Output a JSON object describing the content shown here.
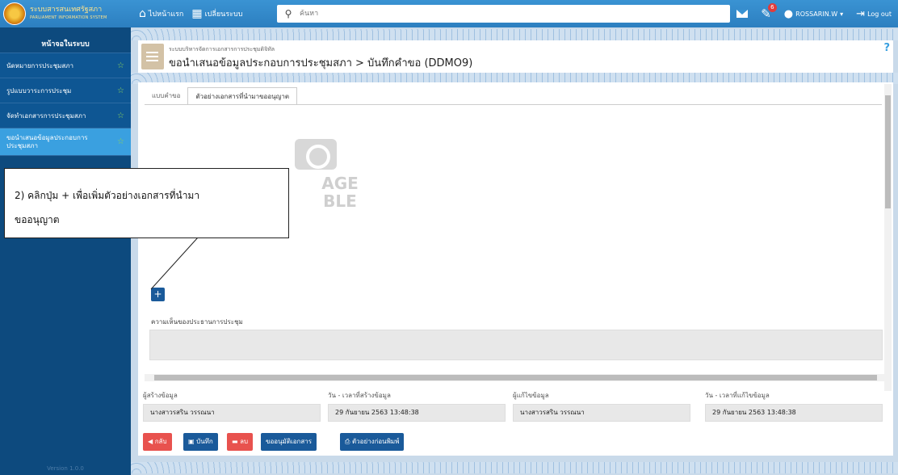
{
  "topbar": {
    "logo_line1": "ระบบสารสนเทศรัฐสภา",
    "logo_line2": "PARLIAMENT INFORMATION SYSTEM",
    "home_label": "ไปหน้าแรก",
    "switch_label": "เปลี่ยนระบบ",
    "search_placeholder": "ค้นหา",
    "notification_count": "6",
    "username": "ROSSARIN.W",
    "logout_label": "Log out"
  },
  "sidebar": {
    "header": "หน้าจอในระบบ",
    "items": [
      {
        "label": "นัดหมายการประชุมสภา"
      },
      {
        "label": "รูปแบบวาระการประชุม"
      },
      {
        "label": "จัดทำเอกสารการประชุมสภา"
      },
      {
        "label": "ขอนำเสนอข้อมูลประกอบการประชุมสภา"
      }
    ],
    "version": "Version 1.0.0"
  },
  "header": {
    "system_name": "ระบบบริหารจัดการเอกสารการประชุมดิจิทัล",
    "title": "ขอนำเสนอข้อมูลประกอบการประชุมสภา > บันทึกคำขอ (DDMO9)",
    "help": "?"
  },
  "tabs": [
    {
      "label": "แบบคำขอ"
    },
    {
      "label": "ตัวอย่างเอกสารที่นำมาขออนุญาต"
    }
  ],
  "placeholder_image": {
    "line1": "IMAGE",
    "line2": "AVAILABLE",
    "visible_line1": "AGE",
    "visible_line2": "BLE"
  },
  "add_button": "+",
  "comment": {
    "label": "ความเห็นของประธานการประชุม",
    "value": ""
  },
  "meta": {
    "created_by_label": "ผู้สร้างข้อมูล",
    "created_by": "นางสาวรสริน วรรณนา",
    "created_at_label": "วัน - เวลาที่สร้างข้อมูล",
    "created_at": "29 กันยายน 2563 13:48:38",
    "modified_by_label": "ผู้แก้ไขข้อมูล",
    "modified_by": "นางสาวรสริน วรรณนา",
    "modified_at_label": "วัน - เวลาที่แก้ไขข้อมูล",
    "modified_at": "29 กันยายน 2563 13:48:38"
  },
  "actions": {
    "back": "กลับ",
    "save": "บันทึก",
    "delete": "ลบ",
    "request_approval": "ขออนุมัติเอกสาร",
    "print_preview": "ตัวอย่างก่อนพิมพ์"
  },
  "callout": {
    "line1": "2) คลิกปุ่ม + เพื่อเพิ่มตัวอย่างเอกสารที่นำมา",
    "line2": "ขออนุญาต"
  },
  "colors": {
    "topbar": "#2c7fc0",
    "sidebar": "#0d4a7e",
    "sidebar_active": "#3aa0e0",
    "primary_button": "#1a5a9a",
    "danger_button": "#e8524e"
  }
}
